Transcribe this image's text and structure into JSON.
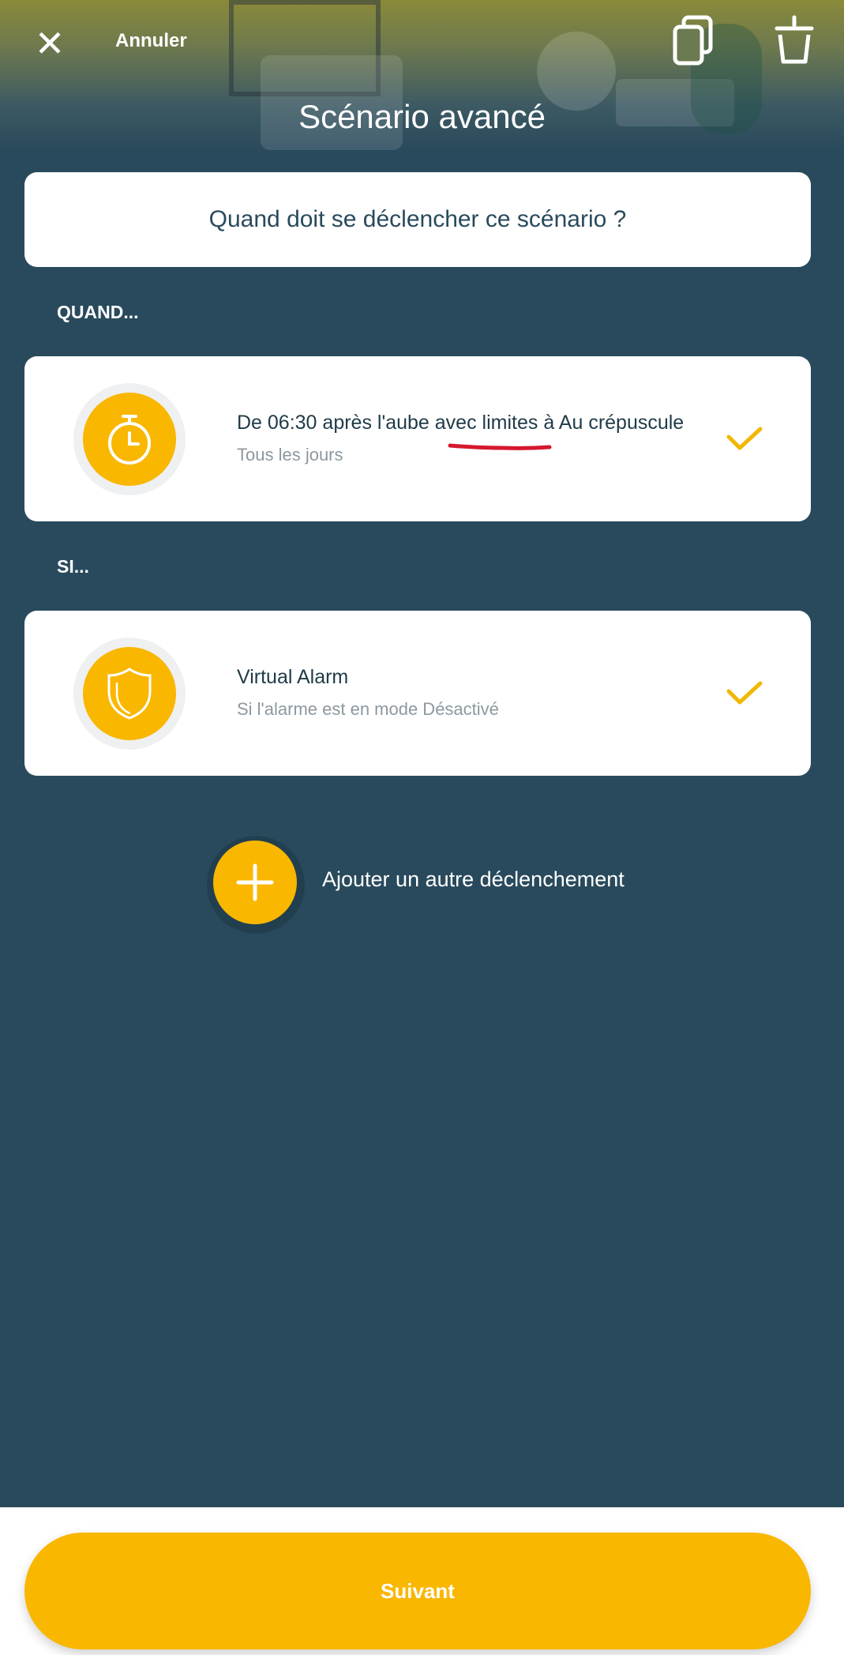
{
  "header": {
    "close_icon": "close-icon",
    "cancel_label": "Annuler",
    "copy_icon": "copy-icon",
    "delete_icon": "trash-icon",
    "title": "Scénario avancé"
  },
  "question": "Quand doit se déclencher ce scénario ?",
  "when_section": {
    "label": "QUAND...",
    "card": {
      "icon": "timer-icon",
      "title": "De 06:30 après l'aube avec limites à Au crépuscule",
      "subtitle": "Tous les jours",
      "status_icon": "check-icon"
    }
  },
  "if_section": {
    "label": "SI...",
    "card": {
      "icon": "shield-icon",
      "title": "Virtual Alarm",
      "subtitle": "Si l'alarme est en mode Désactivé",
      "status_icon": "check-icon"
    }
  },
  "add_trigger": {
    "icon": "plus-icon",
    "label": "Ajouter un autre déclenchement"
  },
  "footer": {
    "next_label": "Suivant"
  },
  "colors": {
    "background": "#294a5c",
    "accent": "#f9b700",
    "annotation_underline": "#d6182d"
  }
}
